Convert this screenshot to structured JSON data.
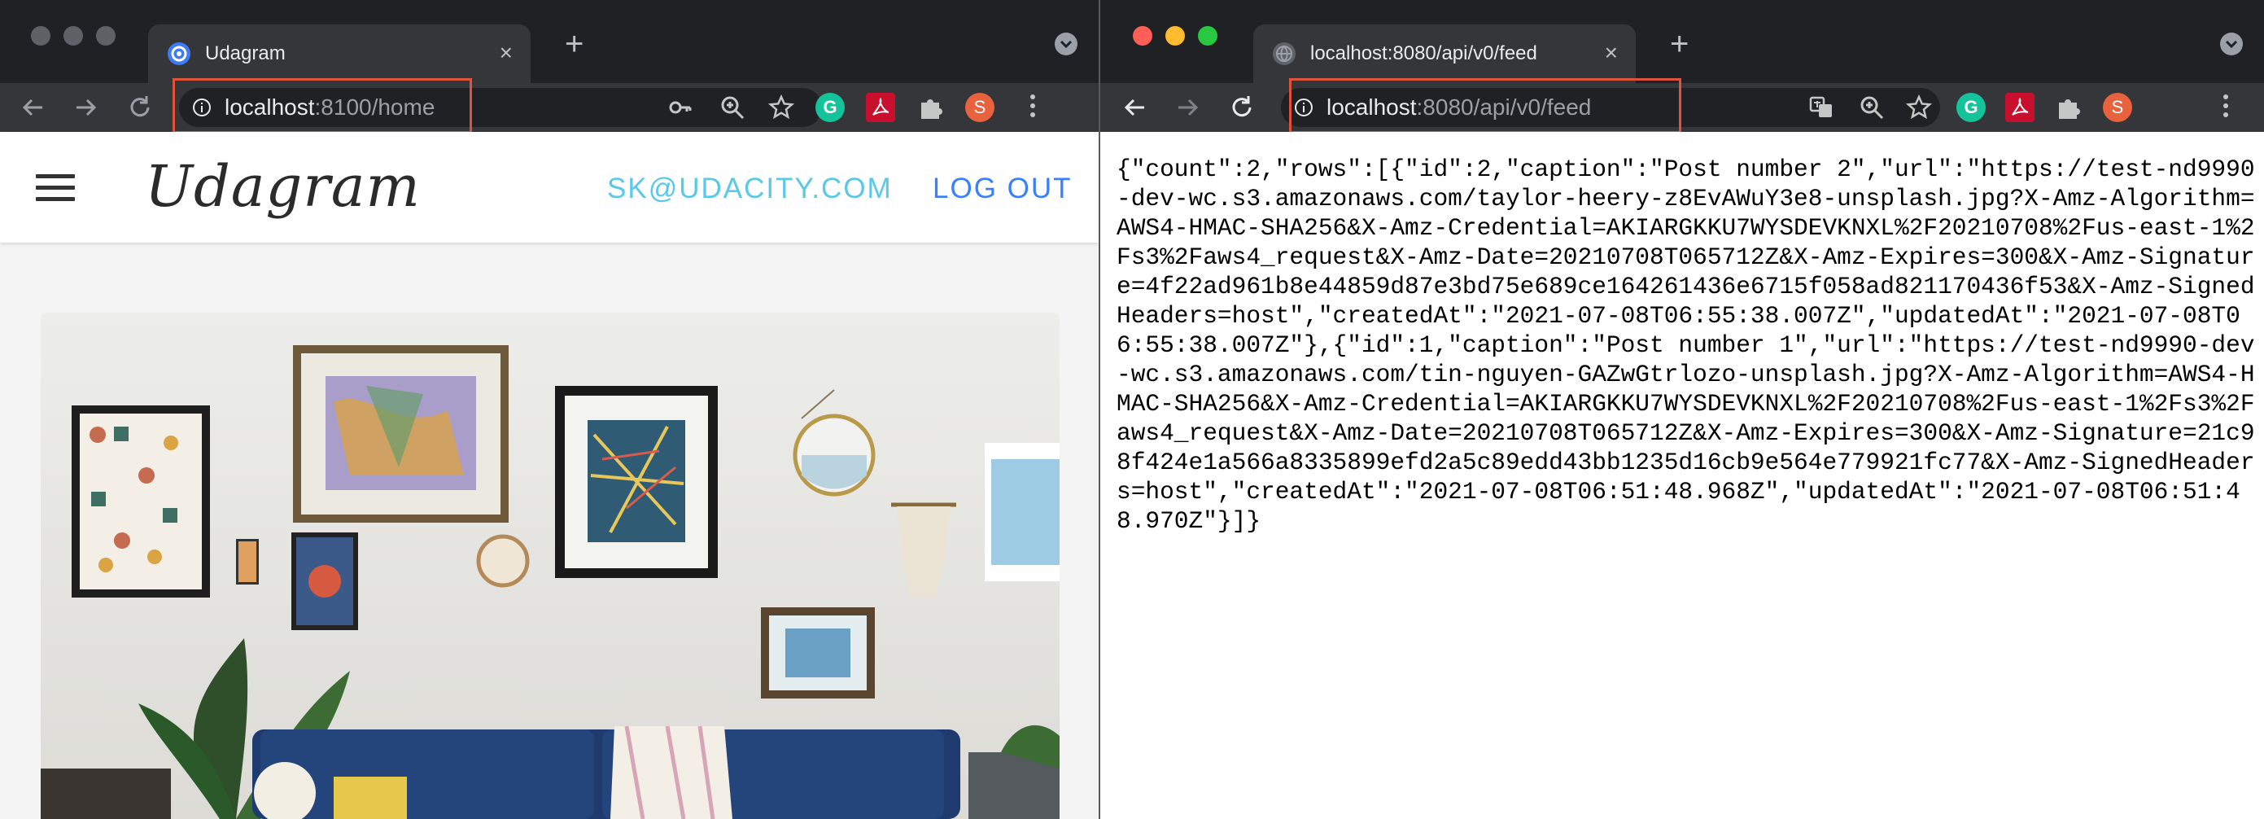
{
  "left_window": {
    "tab": {
      "title": "Udagram",
      "close_glyph": "×",
      "favicon": "ionic-logo-icon"
    },
    "new_tab_glyph": "+",
    "address_bar": {
      "host": "localhost",
      "rest": ":8100/home"
    },
    "app": {
      "brand": "Udagram",
      "user_email": "SK@UDACITY.COM",
      "logout_label": "LOG OUT",
      "colors": {
        "email": "#5ac8e8",
        "logout": "#3880ff"
      }
    },
    "extensions": {
      "grammarly": "G",
      "profile_initial": "S"
    }
  },
  "right_window": {
    "tab": {
      "title": "localhost:8080/api/v0/feed",
      "close_glyph": "×",
      "favicon": "globe-icon"
    },
    "new_tab_glyph": "+",
    "address_bar": {
      "host": "localhost",
      "rest": ":8080/api/v0/feed"
    },
    "extensions": {
      "grammarly": "G",
      "profile_initial": "S"
    },
    "json_text": "{\"count\":2,\"rows\":[{\"id\":2,\"caption\":\"Post number 2\",\"url\":\"https://test-nd9990-dev-wc.s3.amazonaws.com/taylor-heery-z8EvAWuY3e8-unsplash.jpg?X-Amz-Algorithm=AWS4-HMAC-SHA256&X-Amz-Credential=AKIARGKKU7WYSDEVKNXL%2F20210708%2Fus-east-1%2Fs3%2Faws4_request&X-Amz-Date=20210708T065712Z&X-Amz-Expires=300&X-Amz-Signature=4f22ad961b8e44859d87e3bd75e689ce164261436e6715f058ad821170436f53&X-Amz-SignedHeaders=host\",\"createdAt\":\"2021-07-08T06:55:38.007Z\",\"updatedAt\":\"2021-07-08T06:55:38.007Z\"},{\"id\":1,\"caption\":\"Post number 1\",\"url\":\"https://test-nd9990-dev-wc.s3.amazonaws.com/tin-nguyen-GAZwGtrlozo-unsplash.jpg?X-Amz-Algorithm=AWS4-HMAC-SHA256&X-Amz-Credential=AKIARGKKU7WYSDEVKNXL%2F20210708%2Fus-east-1%2Fs3%2Faws4_request&X-Amz-Date=20210708T065712Z&X-Amz-Expires=300&X-Amz-Signature=21c98f424e1a566a8335899efd2a5c89edd43bb1235d16cb9e564e779921fc77&X-Amz-SignedHeaders=host\",\"createdAt\":\"2021-07-08T06:51:48.968Z\",\"updatedAt\":\"2021-07-08T06:51:48.970Z\"}]}"
  },
  "colors": {
    "titlebar": "#202124",
    "toolbar": "#35363a",
    "address_highlight": "#e0533b"
  }
}
